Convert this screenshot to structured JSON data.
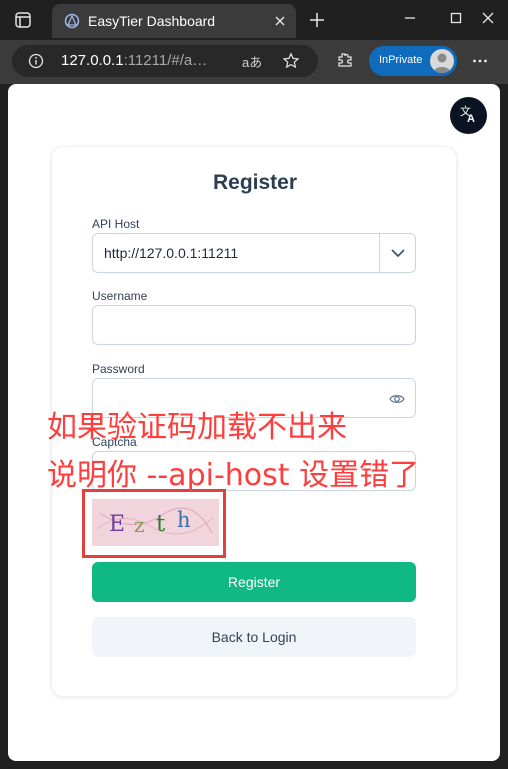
{
  "browser": {
    "tab_title": "EasyTier Dashboard",
    "url_host": "127.0.0.1",
    "url_rest": ":11211/#/a…",
    "read_aloud_label": "aあ",
    "inprivate_label": "InPrivate"
  },
  "register_form": {
    "title": "Register",
    "api_host_label": "API Host",
    "api_host_value": "http://127.0.0.1:11211",
    "username_label": "Username",
    "username_value": "",
    "password_label": "Password",
    "password_value": "",
    "captcha_label": "Captcha",
    "captcha_value": "",
    "captcha_text": [
      "E",
      "z",
      "t",
      "h"
    ],
    "register_button": "Register",
    "back_button": "Back to Login"
  },
  "annotation": {
    "line1": "如果验证码加载不出来",
    "line2": "说明你 --api-host 设置错了"
  },
  "colors": {
    "accent": "#10b981",
    "annotation": "#ff3d3d",
    "inprivate": "#0f6cbd"
  },
  "icons": [
    "tab-actions-icon",
    "tab-favicon-icon",
    "close-icon",
    "plus-icon",
    "minimize-icon",
    "maximize-icon",
    "window-close-icon",
    "info-icon",
    "favorite-icon",
    "extensions-icon",
    "more-icon",
    "translate-icon",
    "chevron-down-icon",
    "eye-icon"
  ]
}
